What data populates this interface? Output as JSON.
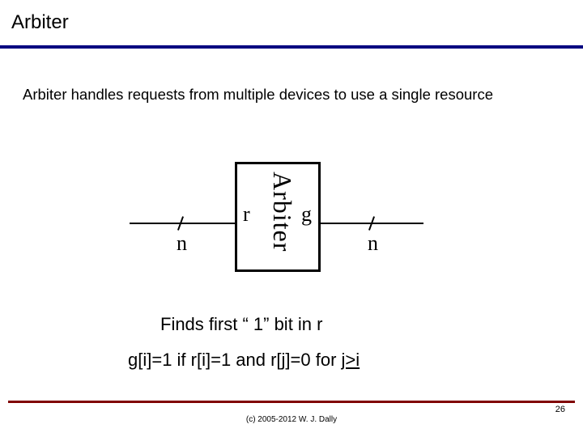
{
  "title": "Arbiter",
  "subtitle": "Arbiter handles requests from multiple devices to use a single resource",
  "diagram": {
    "box_label": "Arbiter",
    "left_port": "r",
    "right_port": "g",
    "left_bus": "n",
    "right_bus": "n"
  },
  "body": {
    "line1": "Finds first “ 1” bit in r",
    "line2_prefix": "g[i]=1 if r[i]=1 and r[j]=0 for ",
    "line2_underlined": "j>i"
  },
  "footer": {
    "copyright": "(c) 2005-2012 W. J. Dally",
    "page": "26"
  }
}
